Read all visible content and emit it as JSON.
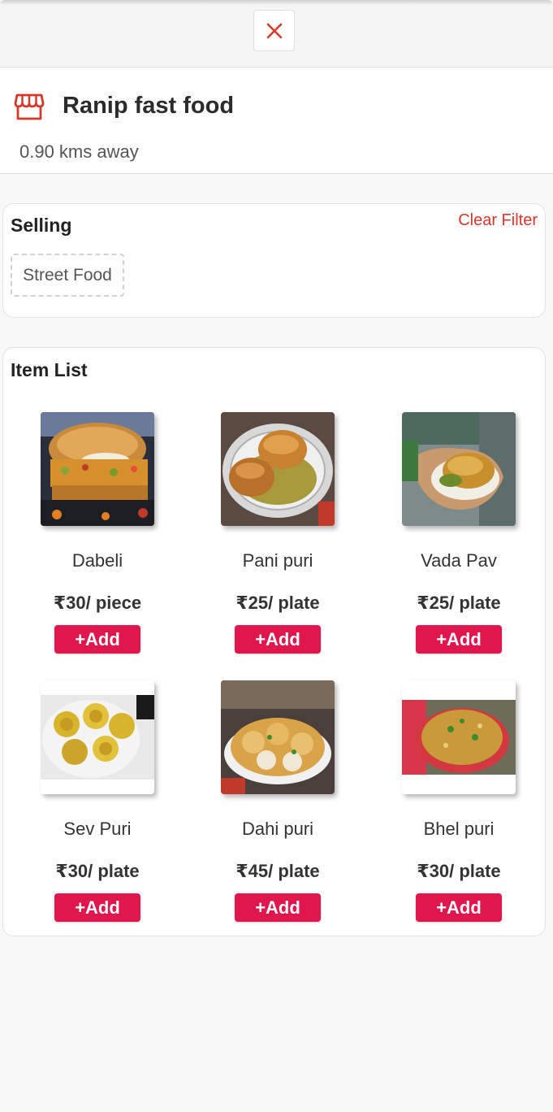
{
  "colors": {
    "accent": "#e0164f",
    "danger": "#d6392c",
    "text": "#222222"
  },
  "header": {
    "close_icon": "close-icon"
  },
  "shop": {
    "icon": "store-icon",
    "name": "Ranip fast food",
    "distance": "0.90 kms away"
  },
  "selling": {
    "title": "Selling",
    "clear_filter_label": "Clear Filter",
    "categories": [
      "Street Food"
    ]
  },
  "item_list": {
    "title": "Item List",
    "add_label": "+Add",
    "items": [
      {
        "name": "Dabeli",
        "price": "₹30/ piece"
      },
      {
        "name": "Pani puri",
        "price": "₹25/ plate"
      },
      {
        "name": "Vada Pav",
        "price": "₹25/ plate"
      },
      {
        "name": "Sev Puri",
        "price": "₹30/ plate"
      },
      {
        "name": "Dahi puri",
        "price": "₹45/ plate"
      },
      {
        "name": "Bhel puri",
        "price": "₹30/ plate"
      }
    ]
  }
}
